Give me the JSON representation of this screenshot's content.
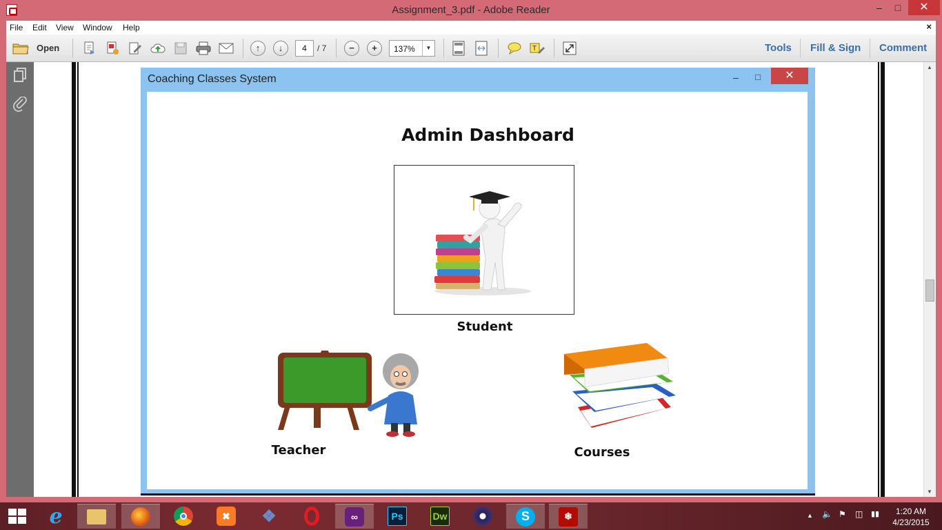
{
  "window": {
    "title": "Assignment_3.pdf - Adobe Reader",
    "minimize": "–",
    "maximize": "□",
    "close": "✕"
  },
  "menu": {
    "items": [
      "File",
      "Edit",
      "View",
      "Window",
      "Help"
    ],
    "close": "×"
  },
  "toolbar": {
    "open_label": "Open",
    "page_current": "4",
    "page_total": "/ 7",
    "zoom": "137%",
    "tools": "Tools",
    "fill_sign": "Fill & Sign",
    "comment": "Comment"
  },
  "app_window": {
    "title": "Coaching Classes System",
    "minimize": "–",
    "maximize": "□",
    "close": "✕",
    "heading": "Admin Dashboard",
    "tiles": {
      "student": "Student",
      "teacher": "Teacher",
      "courses": "Courses"
    }
  },
  "colors": {
    "title_bar": "#d46a76",
    "app_frame": "#8cc3f0",
    "link_blue": "#3a6ea5"
  },
  "taskbar": {
    "apps": [
      "file-explorer",
      "internet-explorer",
      "file-manager",
      "firefox",
      "chrome",
      "xampp",
      "mysql",
      "opera",
      "visual-studio",
      "photoshop",
      "dreamweaver",
      "eclipse",
      "skype",
      "adobe-reader"
    ],
    "time": "1:20 AM",
    "date": "4/23/2015"
  }
}
